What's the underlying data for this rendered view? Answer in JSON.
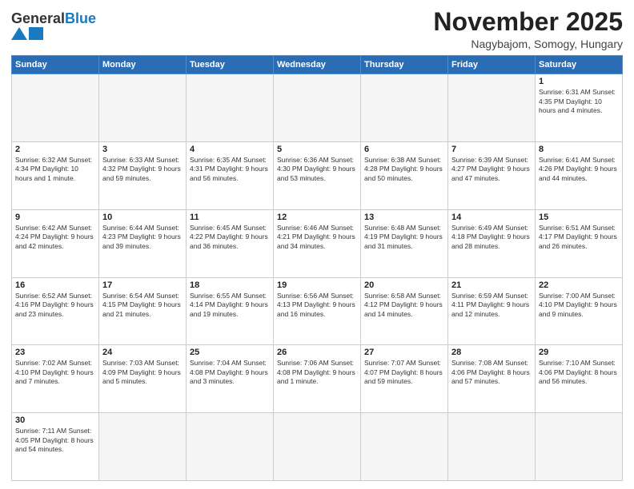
{
  "logo": {
    "text_general": "General",
    "text_blue": "Blue"
  },
  "header": {
    "title": "November 2025",
    "subtitle": "Nagybajom, Somogy, Hungary"
  },
  "weekdays": [
    "Sunday",
    "Monday",
    "Tuesday",
    "Wednesday",
    "Thursday",
    "Friday",
    "Saturday"
  ],
  "weeks": [
    [
      {
        "day": "",
        "info": ""
      },
      {
        "day": "",
        "info": ""
      },
      {
        "day": "",
        "info": ""
      },
      {
        "day": "",
        "info": ""
      },
      {
        "day": "",
        "info": ""
      },
      {
        "day": "",
        "info": ""
      },
      {
        "day": "1",
        "info": "Sunrise: 6:31 AM\nSunset: 4:35 PM\nDaylight: 10 hours and 4 minutes."
      }
    ],
    [
      {
        "day": "2",
        "info": "Sunrise: 6:32 AM\nSunset: 4:34 PM\nDaylight: 10 hours and 1 minute."
      },
      {
        "day": "3",
        "info": "Sunrise: 6:33 AM\nSunset: 4:32 PM\nDaylight: 9 hours and 59 minutes."
      },
      {
        "day": "4",
        "info": "Sunrise: 6:35 AM\nSunset: 4:31 PM\nDaylight: 9 hours and 56 minutes."
      },
      {
        "day": "5",
        "info": "Sunrise: 6:36 AM\nSunset: 4:30 PM\nDaylight: 9 hours and 53 minutes."
      },
      {
        "day": "6",
        "info": "Sunrise: 6:38 AM\nSunset: 4:28 PM\nDaylight: 9 hours and 50 minutes."
      },
      {
        "day": "7",
        "info": "Sunrise: 6:39 AM\nSunset: 4:27 PM\nDaylight: 9 hours and 47 minutes."
      },
      {
        "day": "8",
        "info": "Sunrise: 6:41 AM\nSunset: 4:26 PM\nDaylight: 9 hours and 44 minutes."
      }
    ],
    [
      {
        "day": "9",
        "info": "Sunrise: 6:42 AM\nSunset: 4:24 PM\nDaylight: 9 hours and 42 minutes."
      },
      {
        "day": "10",
        "info": "Sunrise: 6:44 AM\nSunset: 4:23 PM\nDaylight: 9 hours and 39 minutes."
      },
      {
        "day": "11",
        "info": "Sunrise: 6:45 AM\nSunset: 4:22 PM\nDaylight: 9 hours and 36 minutes."
      },
      {
        "day": "12",
        "info": "Sunrise: 6:46 AM\nSunset: 4:21 PM\nDaylight: 9 hours and 34 minutes."
      },
      {
        "day": "13",
        "info": "Sunrise: 6:48 AM\nSunset: 4:19 PM\nDaylight: 9 hours and 31 minutes."
      },
      {
        "day": "14",
        "info": "Sunrise: 6:49 AM\nSunset: 4:18 PM\nDaylight: 9 hours and 28 minutes."
      },
      {
        "day": "15",
        "info": "Sunrise: 6:51 AM\nSunset: 4:17 PM\nDaylight: 9 hours and 26 minutes."
      }
    ],
    [
      {
        "day": "16",
        "info": "Sunrise: 6:52 AM\nSunset: 4:16 PM\nDaylight: 9 hours and 23 minutes."
      },
      {
        "day": "17",
        "info": "Sunrise: 6:54 AM\nSunset: 4:15 PM\nDaylight: 9 hours and 21 minutes."
      },
      {
        "day": "18",
        "info": "Sunrise: 6:55 AM\nSunset: 4:14 PM\nDaylight: 9 hours and 19 minutes."
      },
      {
        "day": "19",
        "info": "Sunrise: 6:56 AM\nSunset: 4:13 PM\nDaylight: 9 hours and 16 minutes."
      },
      {
        "day": "20",
        "info": "Sunrise: 6:58 AM\nSunset: 4:12 PM\nDaylight: 9 hours and 14 minutes."
      },
      {
        "day": "21",
        "info": "Sunrise: 6:59 AM\nSunset: 4:11 PM\nDaylight: 9 hours and 12 minutes."
      },
      {
        "day": "22",
        "info": "Sunrise: 7:00 AM\nSunset: 4:10 PM\nDaylight: 9 hours and 9 minutes."
      }
    ],
    [
      {
        "day": "23",
        "info": "Sunrise: 7:02 AM\nSunset: 4:10 PM\nDaylight: 9 hours and 7 minutes."
      },
      {
        "day": "24",
        "info": "Sunrise: 7:03 AM\nSunset: 4:09 PM\nDaylight: 9 hours and 5 minutes."
      },
      {
        "day": "25",
        "info": "Sunrise: 7:04 AM\nSunset: 4:08 PM\nDaylight: 9 hours and 3 minutes."
      },
      {
        "day": "26",
        "info": "Sunrise: 7:06 AM\nSunset: 4:08 PM\nDaylight: 9 hours and 1 minute."
      },
      {
        "day": "27",
        "info": "Sunrise: 7:07 AM\nSunset: 4:07 PM\nDaylight: 8 hours and 59 minutes."
      },
      {
        "day": "28",
        "info": "Sunrise: 7:08 AM\nSunset: 4:06 PM\nDaylight: 8 hours and 57 minutes."
      },
      {
        "day": "29",
        "info": "Sunrise: 7:10 AM\nSunset: 4:06 PM\nDaylight: 8 hours and 56 minutes."
      }
    ],
    [
      {
        "day": "30",
        "info": "Sunrise: 7:11 AM\nSunset: 4:05 PM\nDaylight: 8 hours and 54 minutes."
      },
      {
        "day": "",
        "info": ""
      },
      {
        "day": "",
        "info": ""
      },
      {
        "day": "",
        "info": ""
      },
      {
        "day": "",
        "info": ""
      },
      {
        "day": "",
        "info": ""
      },
      {
        "day": "",
        "info": ""
      }
    ]
  ]
}
